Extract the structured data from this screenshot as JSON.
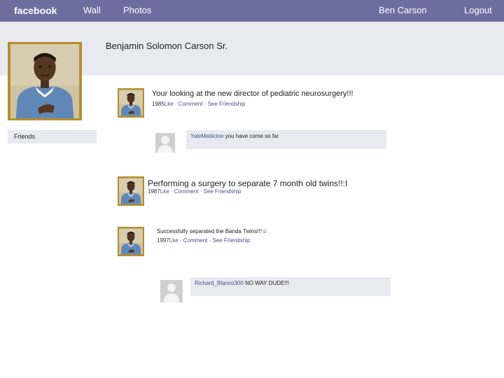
{
  "nav": {
    "brand": "facebook",
    "wall": "Wall",
    "photos": "Photos",
    "user": "Ben Carson",
    "logout": "Logout"
  },
  "profile": {
    "name": "Benjamin Solomon Carson Sr."
  },
  "sidebar": {
    "friends": "Friends"
  },
  "posts": [
    {
      "text": "Your looking at the new director of pediatric neurosurgery!!!",
      "year": "1985",
      "actions": "Lke · Comment · See Friendship",
      "comment": {
        "author": "YaleMedicine",
        "text": "you have come so far"
      }
    },
    {
      "text": "Performing a surgery to separate 7 month old twins!!:I",
      "year": "1987",
      "actions": "Lke · Comment · See Friendship"
    },
    {
      "text": "Successfully separated the Banda Twins!!!☺",
      "year": "1997",
      "actions": "Lke · Comment · See Friendship",
      "comment": {
        "author": "Richard_Blanco300",
        "text": "NO WAY DUDE!!!"
      }
    }
  ]
}
